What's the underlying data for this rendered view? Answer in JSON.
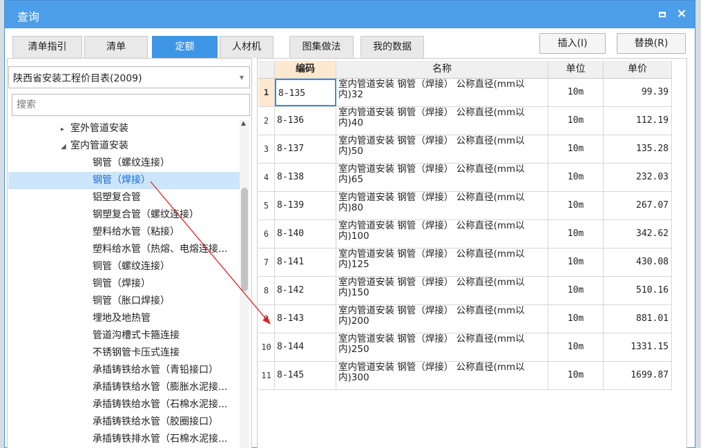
{
  "window": {
    "title": "查询",
    "maximize_label": "maximize",
    "close_label": "×"
  },
  "tabs": [
    {
      "label": "清单指引"
    },
    {
      "label": "清单"
    },
    {
      "label": "定额",
      "active": true
    },
    {
      "label": "人材机"
    },
    {
      "label": "图集做法"
    },
    {
      "label": "我的数据"
    }
  ],
  "buttons": {
    "insert": "插入(I)",
    "replace": "替换(R)"
  },
  "left_panel": {
    "library": "陕西省安装工程价目表(2009)",
    "search_placeholder": "搜索",
    "tree": [
      {
        "label": "室外管道安装",
        "level": 1,
        "toggle": "▸"
      },
      {
        "label": "室内管道安装",
        "level": 1,
        "toggle": "◢"
      },
      {
        "label": "钢管（螺纹连接）",
        "level": 2
      },
      {
        "label": "钢管（焊接）",
        "level": 2,
        "selected": true
      },
      {
        "label": "铝塑复合管",
        "level": 2
      },
      {
        "label": "钢塑复合管（螺纹连接）",
        "level": 2
      },
      {
        "label": "塑料给水管（粘接）",
        "level": 2
      },
      {
        "label": "塑料给水管（热熔、电熔连接...",
        "level": 2
      },
      {
        "label": "铜管（螺纹连接）",
        "level": 2
      },
      {
        "label": "铜管（焊接）",
        "level": 2
      },
      {
        "label": "铜管（胀口焊接）",
        "level": 2
      },
      {
        "label": "埋地及地热管",
        "level": 2
      },
      {
        "label": "管道沟槽式卡箍连接",
        "level": 2
      },
      {
        "label": "不锈钢管卡压式连接",
        "level": 2
      },
      {
        "label": "承插铸铁给水管（青铅接口）",
        "level": 2
      },
      {
        "label": "承插铸铁给水管（膨胀水泥接...",
        "level": 2
      },
      {
        "label": "承插铸铁给水管（石棉水泥接...",
        "level": 2
      },
      {
        "label": "承插铸铁给水管（胶圈接口）",
        "level": 2
      },
      {
        "label": "承插铸铁排水管（石棉水泥接...",
        "level": 2
      }
    ]
  },
  "grid": {
    "headers": {
      "code": "编码",
      "name": "名称",
      "unit": "单位",
      "price": "单价"
    },
    "rows": [
      {
        "num": "1",
        "code": "8-135",
        "name1": "室内管道安装 钢管（焊接） 公称直径(mm以",
        "name2": "内)32",
        "unit": "10m",
        "price": "99.39"
      },
      {
        "num": "2",
        "code": "8-136",
        "name1": "室内管道安装 钢管（焊接） 公称直径(mm以",
        "name2": "内)40",
        "unit": "10m",
        "price": "112.19"
      },
      {
        "num": "3",
        "code": "8-137",
        "name1": "室内管道安装 钢管（焊接） 公称直径(mm以",
        "name2": "内)50",
        "unit": "10m",
        "price": "135.28"
      },
      {
        "num": "4",
        "code": "8-138",
        "name1": "室内管道安装 钢管（焊接） 公称直径(mm以",
        "name2": "内)65",
        "unit": "10m",
        "price": "232.03"
      },
      {
        "num": "5",
        "code": "8-139",
        "name1": "室内管道安装 钢管（焊接） 公称直径(mm以",
        "name2": "内)80",
        "unit": "10m",
        "price": "267.07"
      },
      {
        "num": "6",
        "code": "8-140",
        "name1": "室内管道安装 钢管（焊接） 公称直径(mm以",
        "name2": "内)100",
        "unit": "10m",
        "price": "342.62"
      },
      {
        "num": "7",
        "code": "8-141",
        "name1": "室内管道安装 钢管（焊接） 公称直径(mm以",
        "name2": "内)125",
        "unit": "10m",
        "price": "430.08"
      },
      {
        "num": "8",
        "code": "8-142",
        "name1": "室内管道安装 钢管（焊接） 公称直径(mm以",
        "name2": "内)150",
        "unit": "10m",
        "price": "510.16"
      },
      {
        "num": "9",
        "code": "8-143",
        "name1": "室内管道安装 钢管（焊接） 公称直径(mm以",
        "name2": "内)200",
        "unit": "10m",
        "price": "881.01"
      },
      {
        "num": "10",
        "code": "8-144",
        "name1": "室内管道安装 钢管（焊接） 公称直径(mm以",
        "name2": "内)250",
        "unit": "10m",
        "price": "1331.15"
      },
      {
        "num": "11",
        "code": "8-145",
        "name1": "室内管道安装 钢管（焊接） 公称直径(mm以",
        "name2": "内)300",
        "unit": "10m",
        "price": "1699.87"
      }
    ]
  },
  "colors": {
    "accent": "#3f95e6",
    "titlebar": "#4c9ee9",
    "highlight": "#fde9cf",
    "selection": "#cce5fb",
    "annotation_arrow": "#e02020"
  }
}
